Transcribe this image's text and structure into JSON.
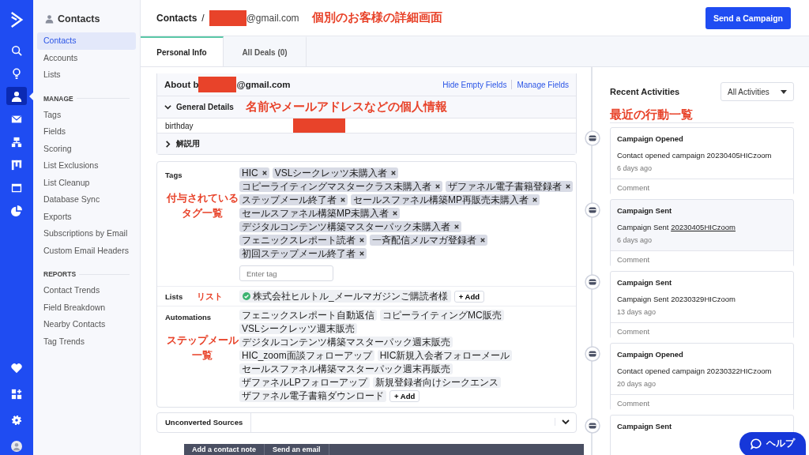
{
  "rail": {
    "top": [
      {
        "kind": "search",
        "selected": false
      },
      {
        "kind": "bulb",
        "selected": false
      },
      {
        "kind": "person",
        "selected": true
      },
      {
        "kind": "mail",
        "selected": false
      },
      {
        "kind": "sitemap",
        "selected": false
      },
      {
        "kind": "board",
        "selected": false
      },
      {
        "kind": "window",
        "selected": false
      },
      {
        "kind": "pie",
        "selected": false
      }
    ],
    "bottom": [
      {
        "kind": "heart",
        "selected": false
      },
      {
        "kind": "apps",
        "selected": false
      },
      {
        "kind": "gear",
        "selected": false
      },
      {
        "kind": "avatar",
        "selected": false
      }
    ]
  },
  "sidebar": {
    "title": "Contacts",
    "items": [
      {
        "label": "Contacts",
        "selected": true
      },
      {
        "label": "Accounts",
        "selected": false
      },
      {
        "label": "Lists",
        "selected": false
      }
    ],
    "sections": [
      {
        "title": "MANAGE",
        "items": [
          {
            "label": "Tags",
            "selected": false
          },
          {
            "label": "Fields",
            "selected": false
          },
          {
            "label": "Scoring",
            "selected": false
          },
          {
            "label": "List Exclusions",
            "selected": false
          },
          {
            "label": "List Cleanup",
            "selected": false
          },
          {
            "label": "Database Sync",
            "selected": false
          },
          {
            "label": "Exports",
            "selected": false
          },
          {
            "label": "Subscriptions by Email",
            "selected": false
          },
          {
            "label": "Custom Email Headers",
            "selected": false
          }
        ]
      },
      {
        "title": "REPORTS",
        "items": [
          {
            "label": "Contact Trends",
            "selected": false
          },
          {
            "label": "Field Breakdown",
            "selected": false
          },
          {
            "label": "Nearby Contacts",
            "selected": false
          },
          {
            "label": "Tag Trends",
            "selected": false
          }
        ]
      }
    ]
  },
  "header": {
    "breadcrumb": "Contacts",
    "separator": "/",
    "email_suffix": "@gmail.com",
    "annotation": "個別のお客様の詳細画面",
    "button": "Send a Campaign"
  },
  "tabs": [
    {
      "label": "Personal Info",
      "selected": true
    },
    {
      "label": "All Deals (0)",
      "selected": false
    }
  ],
  "about": {
    "title_prefix": "About b",
    "title_suffix": "@gmail.com",
    "links": [
      "Hide Empty Fields",
      "Manage Fields"
    ],
    "annotation": "名前やメールアドレスなどの個人情報",
    "sections": [
      {
        "title": "General Details",
        "expanded": true,
        "fields": [
          {
            "label": "birthday"
          }
        ]
      },
      {
        "title": "解説用",
        "expanded": false
      }
    ]
  },
  "tags": {
    "label": "Tags",
    "annotation": [
      "付与されている",
      "タグ一覧"
    ],
    "placeholder": "Enter tag",
    "items": [
      "HIC",
      "VSLシークレッツ未購入者",
      "コピーライティングマスタークラス未購入者",
      "ザファネル電子書籍登録者",
      "ステップメール終了者",
      "セールスファネル構築MP再販売未購入者",
      "セールスファネル構築MP未購入者",
      "デジタルコンテンツ構築マスターパック未購入者",
      "フェニックスレポート読者",
      "一斉配信メルマガ登録者",
      "初回ステップメール終了者"
    ]
  },
  "lists": {
    "label": "Lists",
    "annotation": "リスト",
    "items": [
      "株式会社ヒルトル_メールマガジンご購読者様"
    ],
    "add": "+ Add"
  },
  "automations": {
    "label": "Automations",
    "annotation": [
      "ステップメール",
      "一覧"
    ],
    "items": [
      "フェニックスレポート自動返信",
      "コピーライティングMC販売",
      "VSLシークレッツ週末販売",
      "デジタルコンテンツ構築マスターパック週末販売",
      "HIC_zoom面談フォローアップ",
      "HIC新規入会者フォローメール",
      "セールスファネル構築マスターパック週末再販売",
      "ザファネルLPフォローアップ",
      "新規登録者向けシークエンス",
      "ザファネル電子書籍ダウンロード"
    ],
    "add": "+ Add"
  },
  "unconverted": {
    "title": "Unconverted Sources"
  },
  "activities": {
    "title": "Recent Activities",
    "filter": "All Activities",
    "annotation": "最近の行動一覧",
    "items": [
      {
        "title": "Campaign Opened",
        "text": "Contact opened campaign ",
        "campaign": "20230405HICzoom",
        "linked": false,
        "time": "6 days ago",
        "comment": "Comment"
      },
      {
        "title": "Campaign Sent",
        "text": "Campaign Sent ",
        "campaign": "20230405HICzoom",
        "linked": true,
        "time": "6 days ago",
        "comment": "Comment"
      },
      {
        "title": "Campaign Sent",
        "text": "Campaign Sent ",
        "campaign": "20230329HICzoom",
        "linked": false,
        "time": "13 days ago",
        "comment": "Comment"
      },
      {
        "title": "Campaign Opened",
        "text": "Contact opened campaign ",
        "campaign": "20230322HICzoom",
        "linked": false,
        "time": "20 days ago",
        "comment": "Comment"
      },
      {
        "title": "Campaign Sent"
      }
    ]
  },
  "bottom_bar": [
    "Add a contact note",
    "Send an email"
  ],
  "help": "ヘルプ"
}
